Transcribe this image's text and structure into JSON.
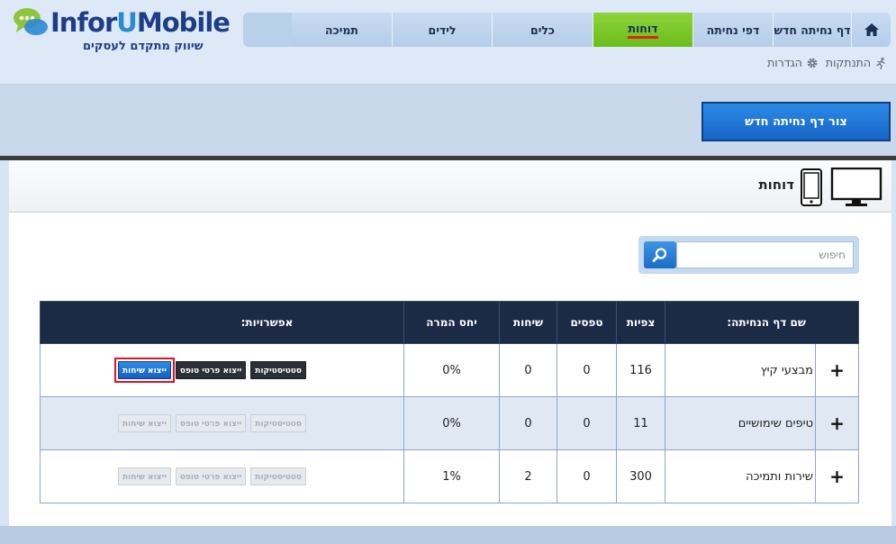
{
  "brand": {
    "logo_text_1": "Infor",
    "logo_text_2": "U",
    "logo_text_3": "Mobile",
    "tagline": "שיווק מתקדם לעסקים"
  },
  "nav": {
    "home_icon": "home-icon",
    "items": [
      {
        "label": "דף נחיתה חדש"
      },
      {
        "label": "דפי נחיתה"
      },
      {
        "label": "דוחות",
        "active": true
      },
      {
        "label": "כלים"
      },
      {
        "label": "לידים"
      },
      {
        "label": "תמיכה"
      }
    ],
    "active_color": "#7bc62a"
  },
  "sub_links": {
    "settings": "הגדרות",
    "logout": "התנתקות"
  },
  "actions": {
    "create_button": "צור דף נחיתה חדש"
  },
  "panel": {
    "title": "דוחות"
  },
  "search": {
    "placeholder": "חיפוש"
  },
  "table": {
    "headers": {
      "name": "שם דף הנחיתה:",
      "views": "צפיות",
      "forms": "טפסים",
      "calls": "שיחות",
      "conversion": "יחס המרה",
      "options": "אפשרויות:"
    },
    "buttons": {
      "stats": "סטטיסטיקות",
      "export_forms": "ייצוא פרטי טופס",
      "export_calls": "ייצוא שיחות"
    },
    "rows": [
      {
        "name": "מבצעי קיץ",
        "views": "116",
        "forms": "0",
        "calls": "0",
        "conversion": "0%",
        "enabled": true
      },
      {
        "name": "טיפים שימושיים",
        "views": "11",
        "forms": "0",
        "calls": "0",
        "conversion": "0%",
        "enabled": false
      },
      {
        "name": "שירות ותמיכה",
        "views": "300",
        "forms": "0",
        "calls": "2",
        "conversion": "1%",
        "enabled": false
      }
    ]
  }
}
